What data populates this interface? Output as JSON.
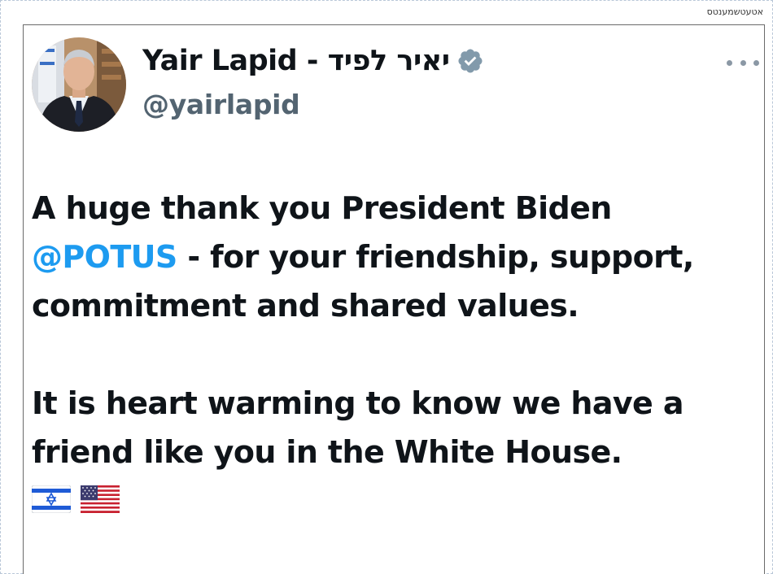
{
  "window": {
    "corner_caption": "אטעטשמענטס"
  },
  "tweet": {
    "author": {
      "display_name": "Yair Lapid - יאיר לפיד",
      "handle": "@yairlapid",
      "verified_color": "#829aab"
    },
    "text": {
      "line1": "A huge thank you President Biden",
      "mention": "@POTUS",
      "line2_rest": " - for your friendship, support,",
      "line3": "commitment and shared values.",
      "line4": "It is heart warming to know we have a",
      "line5": "friend like you in the White House."
    },
    "mention_color": "#1d9bf0",
    "flags": [
      "israel-flag-icon",
      "us-flag-icon"
    ]
  }
}
